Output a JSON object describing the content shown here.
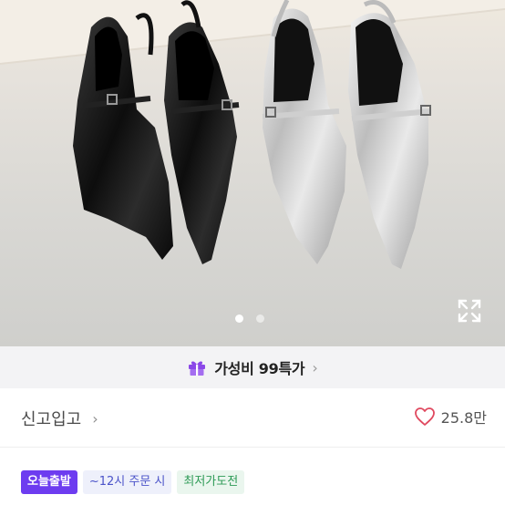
{
  "gallery": {
    "slide_count": 2,
    "active_slide": 1,
    "expand_icon": "expand-icon"
  },
  "promo": {
    "icon": "gift-icon",
    "label": "가성비 99특가",
    "chevron": "›"
  },
  "brand": {
    "name": "신고입고",
    "chevron": "›"
  },
  "likes": {
    "icon": "heart-outline-icon",
    "count": "25.8만",
    "color": "#e0495f"
  },
  "badges": [
    {
      "label": "오늘출발",
      "color": "#6d3cf0"
    },
    {
      "label": "~12시 주문 시",
      "color": "#4b53c9"
    },
    {
      "label": "최저가도전",
      "color": "#2c9a55"
    }
  ]
}
